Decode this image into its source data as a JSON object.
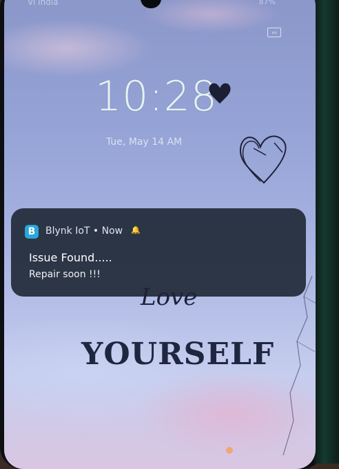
{
  "status_bar": {
    "carrier": "Vi India",
    "battery": "87%"
  },
  "lockscreen": {
    "time": "10:28",
    "date": "Tue, May 14  AM"
  },
  "notification": {
    "app_name": "Blynk IoT",
    "separator": "•",
    "timestamp": "Now",
    "app_icon_letter": "B",
    "title": "Issue Found.....",
    "body": "Repair soon !!!"
  },
  "wallpaper": {
    "script_text": "Love",
    "headline": "YOURSELF"
  },
  "colors": {
    "notification_bg": "#222a38",
    "app_icon": "#2aa6d9",
    "clock": "#e6f3ef",
    "headline": "#1f2640"
  },
  "icons": [
    "heart-icon",
    "bell-icon",
    "lock-screen-badge-icon"
  ]
}
